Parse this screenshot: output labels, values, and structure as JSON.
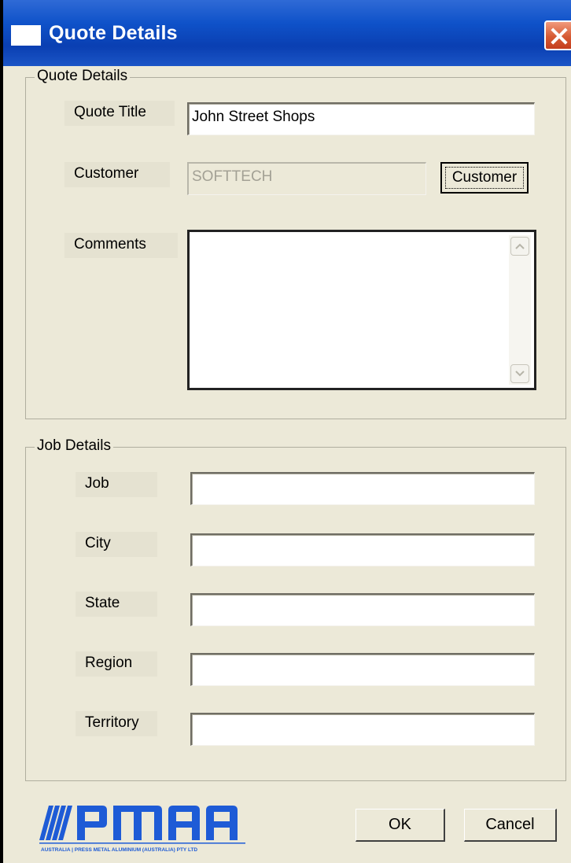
{
  "window": {
    "title": "Quote Details"
  },
  "quote_group": {
    "legend": "Quote Details",
    "quote_title_label": "Quote Title",
    "quote_title_value": "John Street Shops",
    "customer_label": "Customer",
    "customer_value": "SOFTTECH",
    "customer_button": "Customer",
    "comments_label": "Comments",
    "comments_value": ""
  },
  "job_group": {
    "legend": "Job Details",
    "fields": [
      {
        "label": "Job",
        "value": ""
      },
      {
        "label": "City",
        "value": ""
      },
      {
        "label": "State",
        "value": ""
      },
      {
        "label": "Region",
        "value": ""
      },
      {
        "label": "Territory",
        "value": ""
      }
    ]
  },
  "footer": {
    "ok_label": "OK",
    "cancel_label": "Cancel"
  },
  "logo": {
    "name": "PMAA",
    "tagline": "AUSTRALIA | PRESS METAL ALUMINIUM (AUSTRALIA) PTY LTD",
    "brand_color": "#1e5bd6"
  }
}
